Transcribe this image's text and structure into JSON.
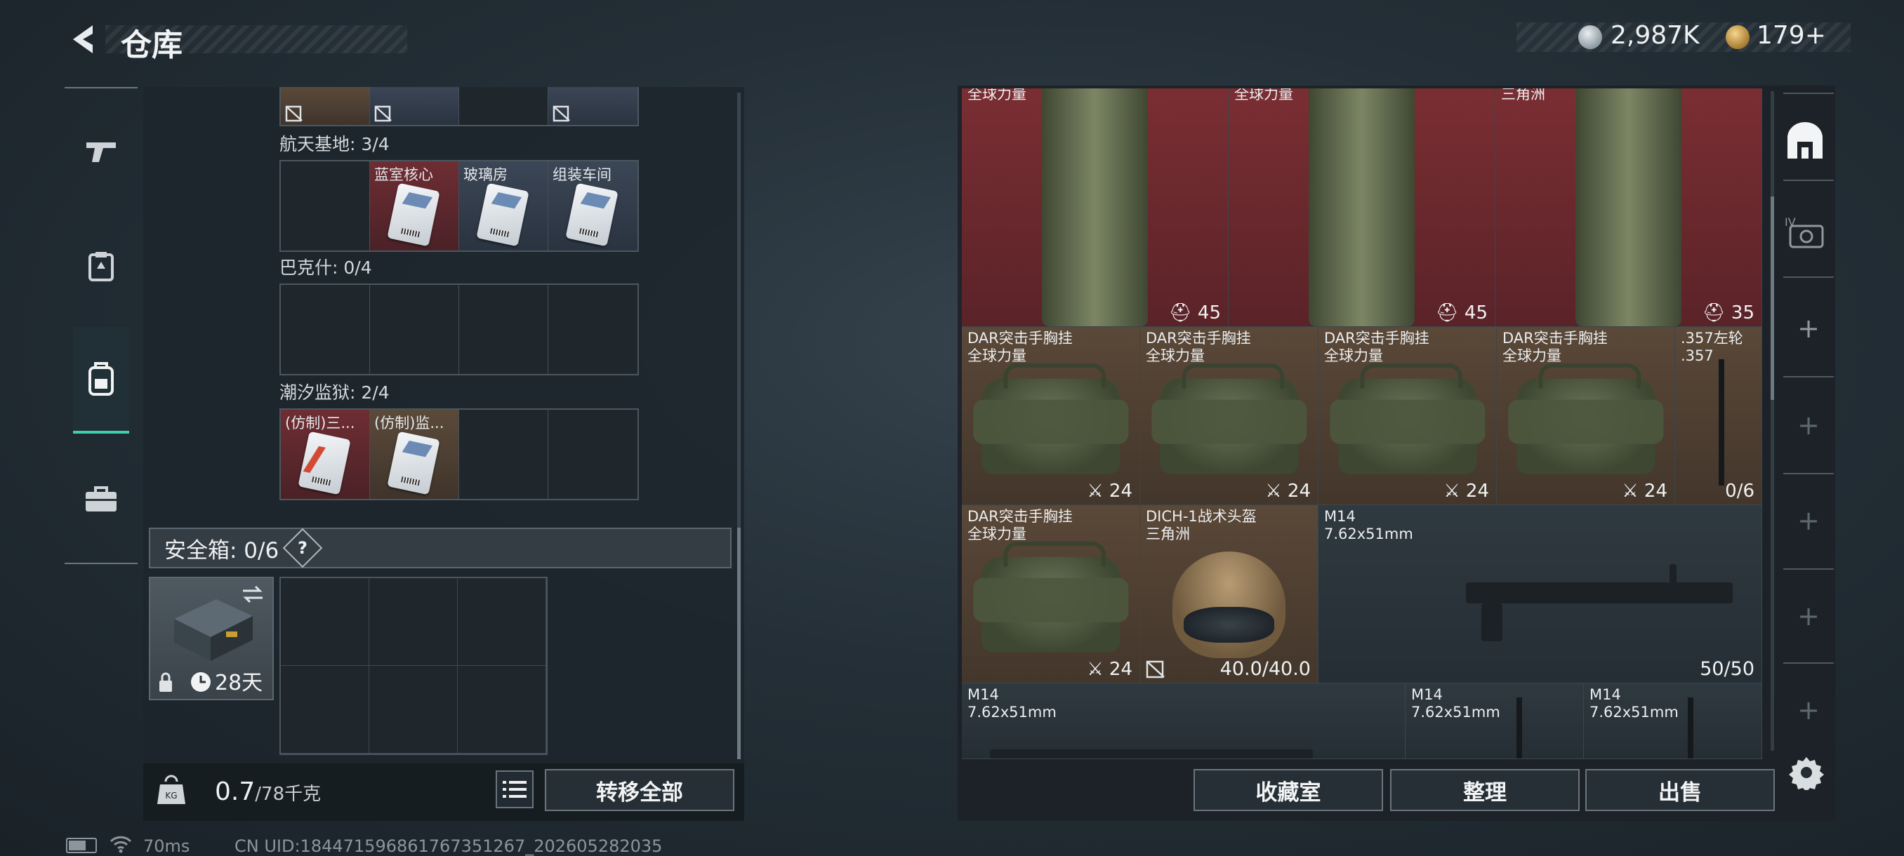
{
  "header": {
    "title": "仓库",
    "back_icon": "back-arrow-icon"
  },
  "currency": [
    {
      "icon": "silver-coin-icon",
      "value": "2,987K"
    },
    {
      "icon": "gold-coin-icon",
      "value": "179+"
    }
  ],
  "left_nav": [
    {
      "icon": "gun-icon",
      "active": false
    },
    {
      "icon": "armor-icon",
      "active": false
    },
    {
      "icon": "backpack-icon",
      "active": true
    },
    {
      "icon": "briefcase-icon",
      "active": false
    }
  ],
  "key_groups": [
    {
      "label": "航天基地: 3/4",
      "cells": [
        {
          "name": "",
          "color": "empty"
        },
        {
          "name": "蓝室核心",
          "color": "red"
        },
        {
          "name": "玻璃房",
          "color": "blue"
        },
        {
          "name": "组装车间",
          "color": "blue"
        }
      ]
    },
    {
      "label": "巴克什: 0/4",
      "cells": [
        {
          "name": "",
          "color": "empty"
        },
        {
          "name": "",
          "color": "empty"
        },
        {
          "name": "",
          "color": "empty"
        },
        {
          "name": "",
          "color": "empty"
        }
      ]
    },
    {
      "label": "潮汐监狱: 2/4",
      "cells": [
        {
          "name": "(仿制)三...",
          "color": "red"
        },
        {
          "name": "(仿制)监...",
          "color": "gold"
        },
        {
          "name": "",
          "color": "empty"
        },
        {
          "name": "",
          "color": "empty"
        }
      ]
    }
  ],
  "safe_box": {
    "label": "安全箱:  0/6",
    "help": "?",
    "days": "28天",
    "swap_icon": "swap-icon",
    "lock_icon": "lock-icon",
    "clock_icon": "clock-icon"
  },
  "footer_left": {
    "weight_value": "0.7",
    "weight_max": "/78千克",
    "transfer_all": "转移全部",
    "list_icon": "list-icon"
  },
  "items": [
    {
      "name": "全球力量",
      "count": "45",
      "icon": "durability-icon"
    },
    {
      "name": "全球力量",
      "count": "45",
      "icon": "durability-icon"
    },
    {
      "name": "三角洲",
      "count": "35",
      "icon": "durability-icon"
    },
    {
      "name": "DAR突击手胸挂\n全球力量",
      "count": "24"
    },
    {
      "name": "DAR突击手胸挂\n全球力量",
      "count": "24"
    },
    {
      "name": "DAR突击手胸挂\n全球力量",
      "count": "24"
    },
    {
      "name": "DAR突击手胸挂\n全球力量",
      "count": "24"
    },
    {
      "name": ".357左轮\n.357",
      "count": "0/6"
    },
    {
      "name": "DAR突击手胸挂\n全球力量",
      "count": "24"
    },
    {
      "name": "DICH-1战术头盔\n三角洲",
      "count": "40.0/40.0"
    },
    {
      "name": "M14\n7.62x51mm",
      "count": "50/50"
    },
    {
      "name": "M14\n7.62x51mm",
      "count": ""
    },
    {
      "name": "M14\n7.62x51mm",
      "count": ""
    },
    {
      "name": "M14\n7.62x51mm",
      "count": ""
    }
  ],
  "footer_right": {
    "collection": "收藏室",
    "sort": "整理",
    "sell": "出售"
  },
  "right_nav": {
    "top_icon": "vault-icon",
    "second_icon": "ticket-icon",
    "settings_icon": "gear-icon",
    "plus": "+"
  },
  "status": {
    "ping": "70ms",
    "uid": "CN UID:1844715968617673512​67_202605282035"
  }
}
